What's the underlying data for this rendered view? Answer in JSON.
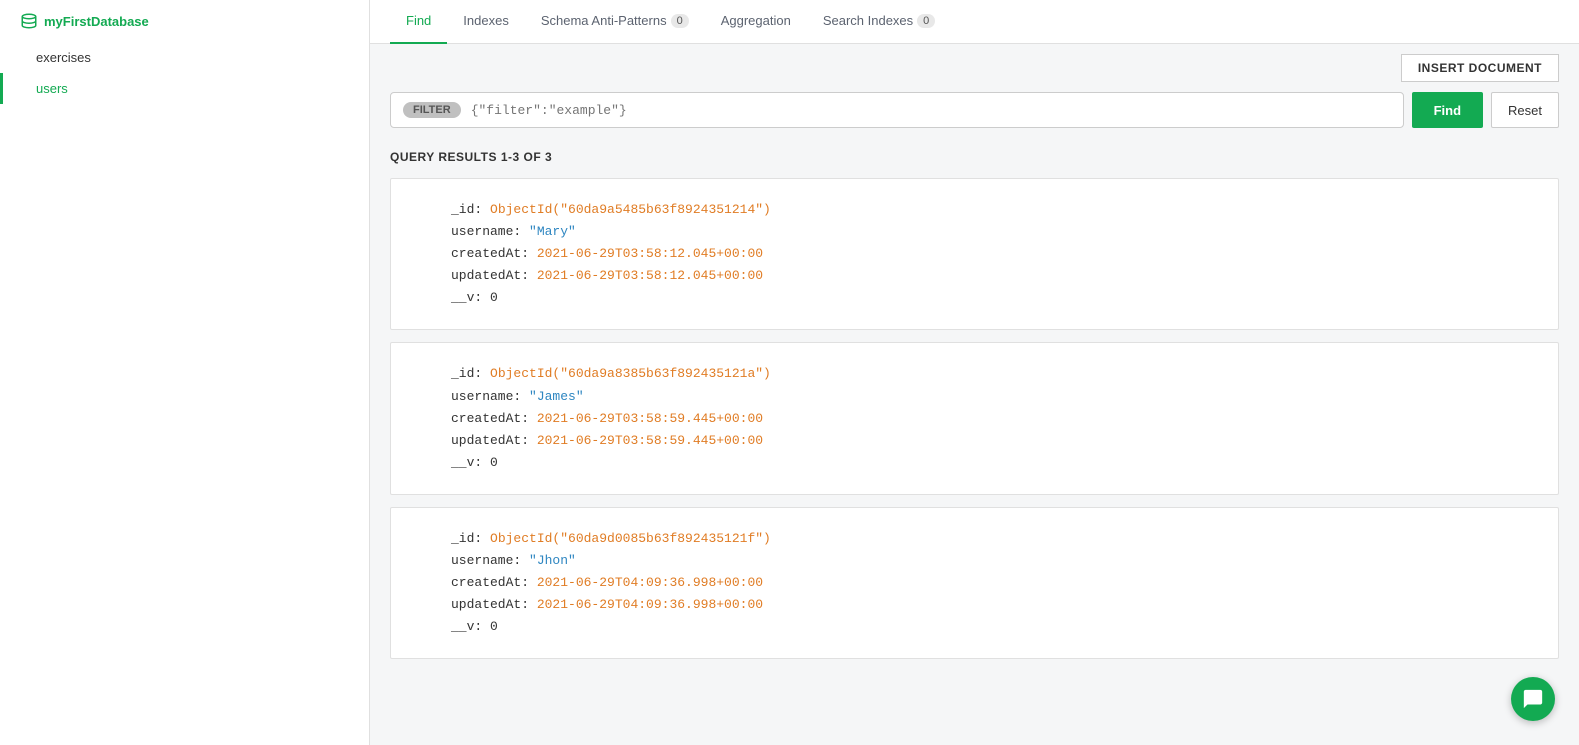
{
  "sidebar": {
    "db_name": "myFirstDatabase",
    "collections": [
      {
        "name": "exercises",
        "active": false
      },
      {
        "name": "users",
        "active": true
      }
    ]
  },
  "tabs": [
    {
      "label": "Find",
      "active": true
    },
    {
      "label": "Indexes",
      "active": false
    },
    {
      "label": "Schema Anti-Patterns",
      "active": false,
      "badge": "0"
    },
    {
      "label": "Aggregation",
      "active": false
    },
    {
      "label": "Search Indexes",
      "active": false,
      "badge": "0"
    }
  ],
  "toolbar": {
    "insert_doc_label": "INSERT DOCUMENT"
  },
  "filter": {
    "badge": "FILTER",
    "placeholder": "{\"filter\":\"example\"}",
    "find_label": "Find",
    "reset_label": "Reset"
  },
  "query_results": {
    "prefix": "QUERY RESULTS",
    "range": "1-3 OF 3",
    "documents": [
      {
        "id": "_id",
        "objectid": "ObjectId(\"60da9a5485b63f8924351214\")",
        "username_key": "username",
        "username_val": "\"Mary\"",
        "createdAt_key": "createdAt",
        "createdAt_val": "2021-06-29T03:58:12.045+00:00",
        "updatedAt_key": "updatedAt",
        "updatedAt_val": "2021-06-29T03:58:12.045+00:00",
        "v_key": "__v",
        "v_val": "0"
      },
      {
        "id": "_id",
        "objectid": "ObjectId(\"60da9a8385b63f892435121a\")",
        "username_key": "username",
        "username_val": "\"James\"",
        "createdAt_key": "createdAt",
        "createdAt_val": "2021-06-29T03:58:59.445+00:00",
        "updatedAt_key": "updatedAt",
        "updatedAt_val": "2021-06-29T03:58:59.445+00:00",
        "v_key": "__v",
        "v_val": "0"
      },
      {
        "id": "_id",
        "objectid": "ObjectId(\"60da9d0085b63f892435121f\")",
        "username_key": "username",
        "username_val": "\"Jhon\"",
        "createdAt_key": "createdAt",
        "createdAt_val": "2021-06-29T04:09:36.998+00:00",
        "updatedAt_key": "updatedAt",
        "updatedAt_val": "2021-06-29T04:09:36.998+00:00",
        "v_key": "__v",
        "v_val": "0"
      }
    ]
  }
}
